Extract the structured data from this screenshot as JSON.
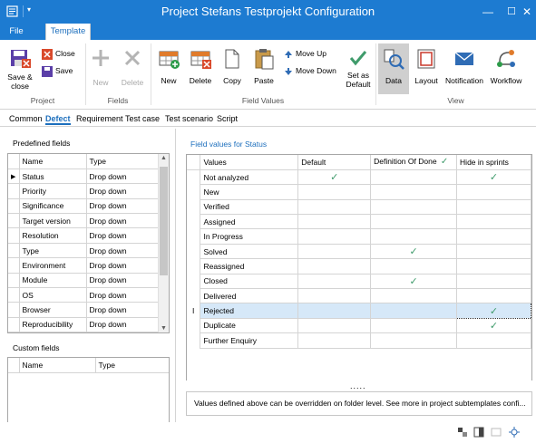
{
  "window": {
    "title": "Project Stefans Testprojekt Configuration"
  },
  "ribbon_tabs": [
    {
      "label": "File"
    },
    {
      "label": "Template"
    }
  ],
  "ribbon": {
    "project": {
      "save_close": "Save &",
      "save_close2": "close",
      "close": "Close",
      "save": "Save",
      "group": "Project"
    },
    "fields": {
      "new": "New",
      "delete": "Delete",
      "group": "Fields"
    },
    "field_values": {
      "new": "New",
      "delete": "Delete",
      "copy": "Copy",
      "paste": "Paste",
      "move_up": "Move Up",
      "move_down": "Move Down",
      "set_default_1": "Set as",
      "set_default_2": "Default",
      "group": "Field Values"
    },
    "view": {
      "data": "Data",
      "layout": "Layout",
      "notification": "Notification",
      "workflow": "Workflow",
      "group": "View"
    }
  },
  "sub_tabs": [
    "Common",
    "Defect",
    "Requirement",
    "Test case",
    "Test scenario",
    "Script"
  ],
  "predefined": {
    "title": "Predefined fields",
    "columns": [
      "Name",
      "Type"
    ],
    "rows": [
      {
        "name": "Status",
        "type": "Drop down"
      },
      {
        "name": "Priority",
        "type": "Drop down"
      },
      {
        "name": "Significance",
        "type": "Drop down"
      },
      {
        "name": "Target version",
        "type": "Drop down"
      },
      {
        "name": "Resolution",
        "type": "Drop down"
      },
      {
        "name": "Type",
        "type": "Drop down"
      },
      {
        "name": "Environment",
        "type": "Drop down"
      },
      {
        "name": "Module",
        "type": "Drop down"
      },
      {
        "name": "OS",
        "type": "Drop down"
      },
      {
        "name": "Browser",
        "type": "Drop down"
      },
      {
        "name": "Reproducibility",
        "type": "Drop down"
      }
    ]
  },
  "custom": {
    "title": "Custom fields",
    "columns": [
      "Name",
      "Type"
    ]
  },
  "field_values": {
    "title": "Field values for Status",
    "columns": [
      "Values",
      "Default",
      "Definition Of Done",
      "Hide in sprints"
    ],
    "rows": [
      {
        "value": "Not analyzed",
        "default": true,
        "dod": false,
        "hide": true
      },
      {
        "value": "New",
        "default": false,
        "dod": false,
        "hide": false
      },
      {
        "value": "Verified",
        "default": false,
        "dod": false,
        "hide": false
      },
      {
        "value": "Assigned",
        "default": false,
        "dod": false,
        "hide": false
      },
      {
        "value": "In Progress",
        "default": false,
        "dod": false,
        "hide": false
      },
      {
        "value": "Solved",
        "default": false,
        "dod": true,
        "hide": false
      },
      {
        "value": "Reassigned",
        "default": false,
        "dod": false,
        "hide": false
      },
      {
        "value": "Closed",
        "default": false,
        "dod": true,
        "hide": false
      },
      {
        "value": "Delivered",
        "default": false,
        "dod": false,
        "hide": false
      },
      {
        "value": "Rejected",
        "default": false,
        "dod": false,
        "hide": true
      },
      {
        "value": "Duplicate",
        "default": false,
        "dod": false,
        "hide": true
      },
      {
        "value": "Further Enquiry",
        "default": false,
        "dod": false,
        "hide": false
      }
    ],
    "more": ".....",
    "info": "Values defined above can be overridden on folder level. See more in project subtemplates confi..."
  },
  "colors": {
    "accent": "#1d7bd1",
    "check": "#3f9b6b"
  }
}
